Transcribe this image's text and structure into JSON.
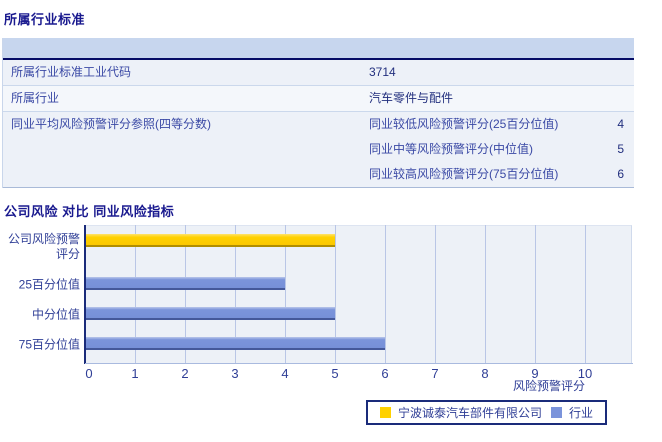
{
  "page": {
    "section1_title": "所属行业标准",
    "section2_title": "公司风险 对比 同业风险指标"
  },
  "industry_table": {
    "rows": [
      {
        "label": "所属行业标准工业代码",
        "value": "3714"
      },
      {
        "label": "所属行业",
        "value": "汽车零件与配件"
      },
      {
        "label": "同业平均风险预警评分参照(四等分数)",
        "sub_rows": [
          {
            "label": "同业较低风险预警评分(25百分位值)",
            "value": "4"
          },
          {
            "label": "同业中等风险预警评分(中位值)",
            "value": "5"
          },
          {
            "label": "同业较高风险预警评分(75百分位值)",
            "value": "6"
          }
        ]
      }
    ]
  },
  "chart_data": {
    "type": "bar",
    "orientation": "horizontal",
    "title": "公司风险 对比 同业风险指标",
    "categories": [
      "公司风险预警评分",
      "25百分位值",
      "中分位值",
      "75百分位值"
    ],
    "series": [
      {
        "name": "宁波诚泰汽车部件有限公司",
        "color": "#ffd100",
        "values": [
          5,
          null,
          null,
          null
        ]
      },
      {
        "name": "行业",
        "color": "#7b94db",
        "values": [
          null,
          4,
          5,
          6
        ]
      }
    ],
    "xlabel": "风险预警评分",
    "xlim": [
      0,
      10
    ],
    "xticks": [
      0,
      1,
      2,
      3,
      4,
      5,
      6,
      7,
      8,
      9,
      10
    ],
    "grid": "vertical",
    "legend_position": "bottom-right",
    "colors": {
      "company_bar": "#ffd100",
      "industry_bar": "#7b94db",
      "plot_background": "#edf1f7",
      "gridline": "#b9c6e6",
      "axis": "#1a2b7a",
      "text": "#2f3e96"
    }
  }
}
